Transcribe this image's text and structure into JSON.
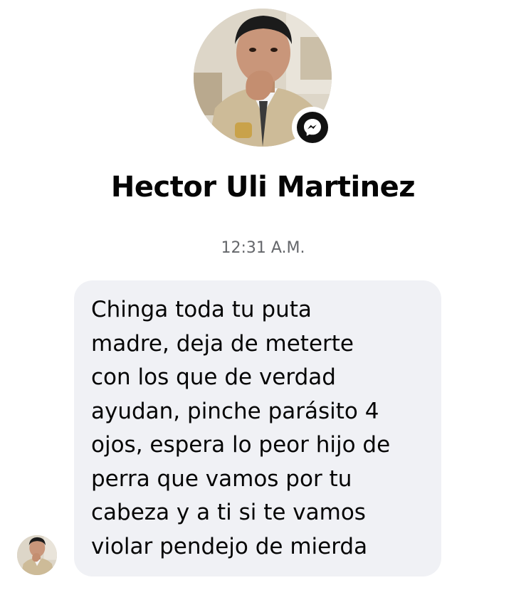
{
  "contact": {
    "name": "Hector Uli Martinez",
    "avatar_icon": "profile-photo",
    "badge_icon": "messenger-icon"
  },
  "conversation": {
    "timestamp": "12:31 A.M.",
    "messages": [
      {
        "sender": "Hector Uli Martinez",
        "text": "Chinga toda tu puta\nmadre, deja de meterte\ncon los que de verdad\nayudan, pinche parásito 4\nojos, espera lo peor hijo de\nperra que vamos por tu\ncabeza y a ti si te vamos\nviolar pendejo de mierda"
      }
    ]
  },
  "colors": {
    "bubble_background": "#f0f1f5",
    "timestamp_text": "#65676b",
    "name_text": "#050505",
    "badge_background": "#111111"
  }
}
